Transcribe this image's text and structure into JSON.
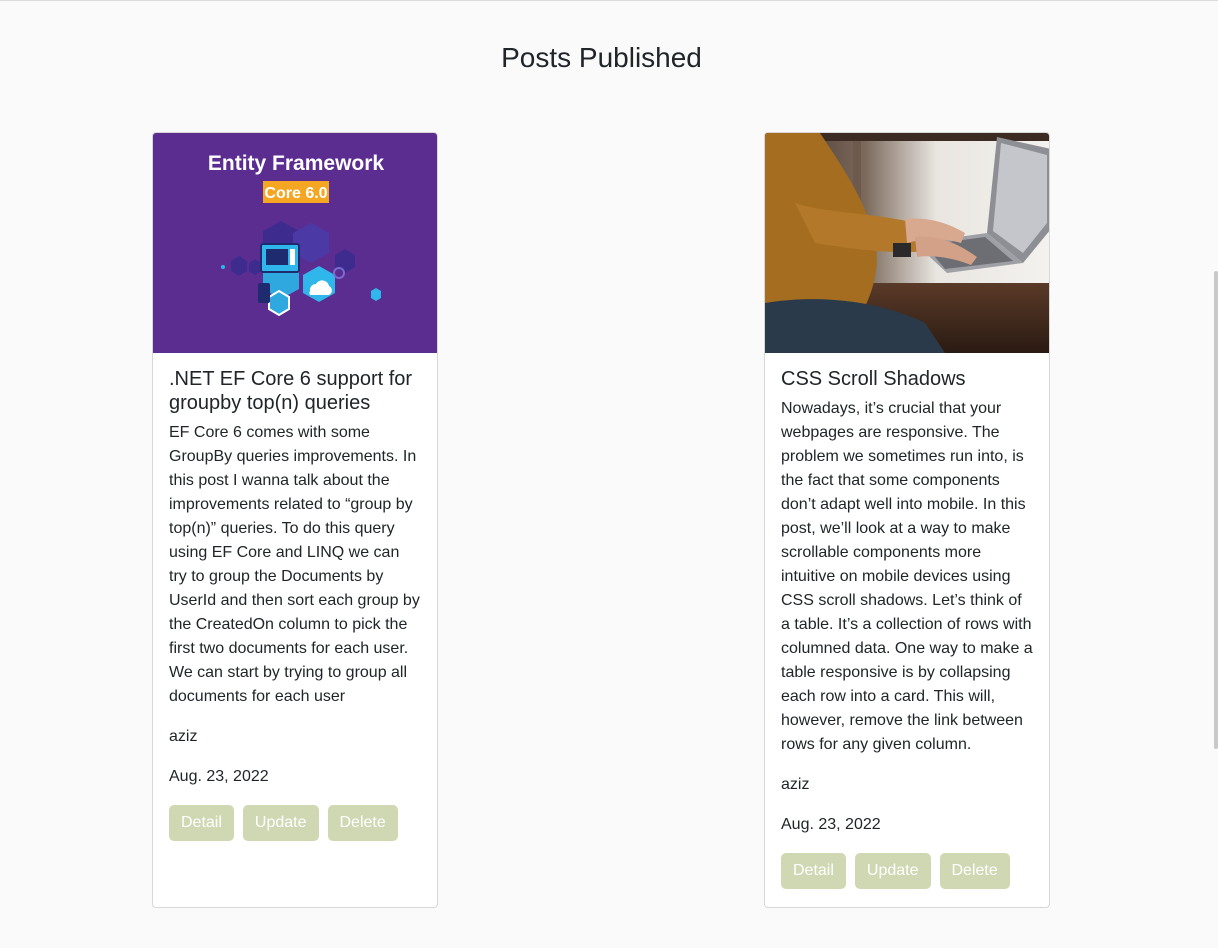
{
  "page": {
    "title": "Posts Published"
  },
  "posts": [
    {
      "image_text": {
        "line1": "Entity Framework",
        "line2": "Core 6.0"
      },
      "title": ".NET EF Core 6 support for groupby top(n) queries",
      "body": "EF Core 6 comes with some GroupBy queries improvements. In this post I wanna talk about the improvements related to “group by top(n)” queries. To do this query using EF Core and LINQ we can try to group the Documents by UserId and then sort each group by the CreatedOn column to pick the first two documents for each user. We can start by trying to group all documents for each user",
      "author": "aziz",
      "date": "Aug. 23, 2022",
      "buttons": {
        "detail": "Detail",
        "update": "Update",
        "delete": "Delete"
      }
    },
    {
      "title": "CSS Scroll Shadows",
      "body": "Nowadays, it’s crucial that your webpages are responsive. The problem we sometimes run into, is the fact that some components don’t adapt well into mobile. In this post, we’ll look at a way to make scrollable components more intuitive on mobile devices using CSS scroll shadows. Let’s think of a table. It’s a collection of rows with columned data. One way to make a table responsive is by collapsing each row into a card. This will, however, remove the link between rows for any given column.",
      "author": "aziz",
      "date": "Aug. 23, 2022",
      "buttons": {
        "detail": "Detail",
        "update": "Update",
        "delete": "Delete"
      }
    }
  ],
  "colors": {
    "button_bg": "#cfd8b3",
    "ef_image_bg": "#5c2d91",
    "ef_badge_bg": "#f5a623",
    "page_bg": "#fafafa"
  }
}
